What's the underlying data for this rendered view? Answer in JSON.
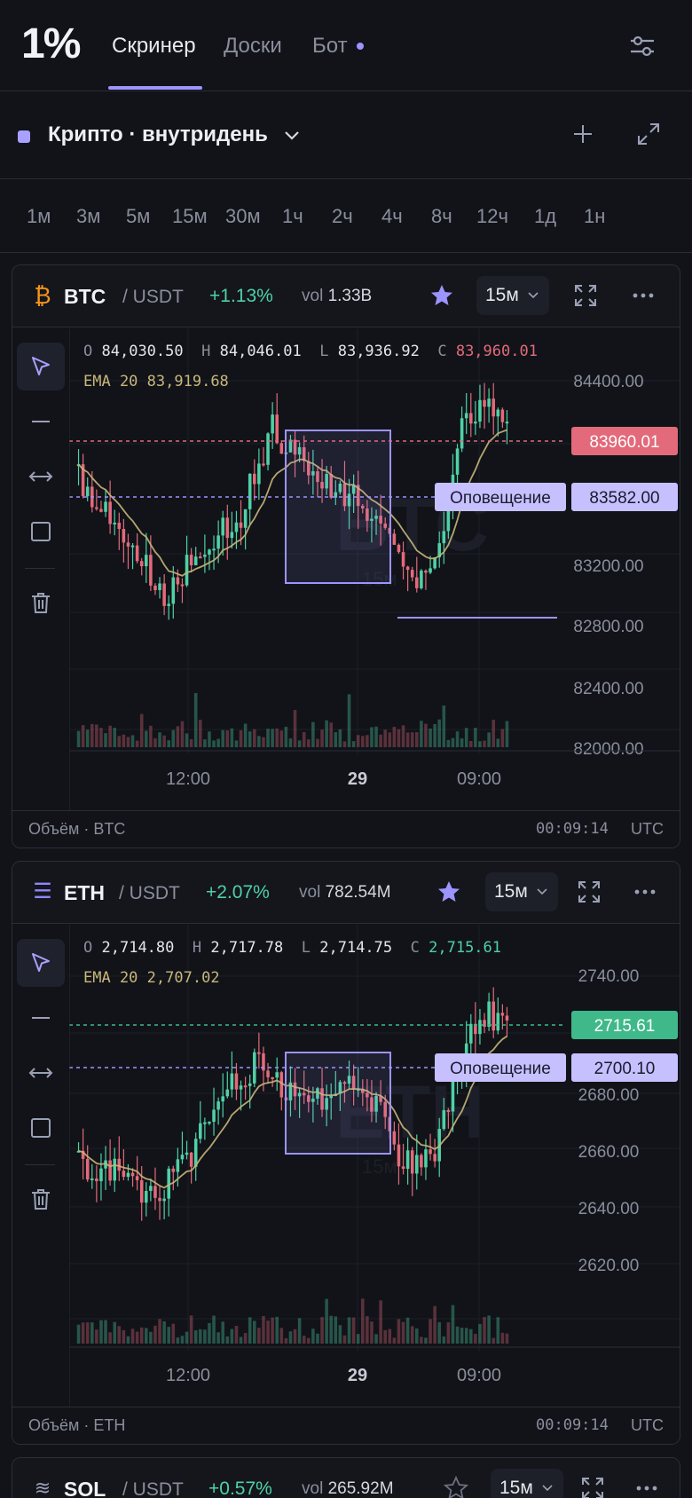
{
  "app": {
    "logo": "1%"
  },
  "nav": {
    "tabs": [
      {
        "label": "Скринер"
      },
      {
        "label": "Доски"
      },
      {
        "label": "Бот"
      }
    ]
  },
  "board": {
    "name": "Крипто · внутридень"
  },
  "intervals": [
    "1м",
    "3м",
    "5м",
    "15м",
    "30м",
    "1ч",
    "2ч",
    "4ч",
    "8ч",
    "12ч",
    "1д",
    "1н"
  ],
  "cards": [
    {
      "symbol": "BTC",
      "quote": "/ USDT",
      "change": "+1.13%",
      "vol_label": "vol",
      "vol_value": "1.33B",
      "timeframe": "15м",
      "icon": "bitcoin-icon",
      "icon_color": "#f7931a",
      "ohlc": {
        "o_label": "O",
        "o": "84,030.50",
        "h_label": "H",
        "h": "84,046.01",
        "l_label": "L",
        "l": "83,936.92",
        "c_label": "C",
        "c": "83,960.01",
        "c_dir": "down"
      },
      "ema": {
        "label": "EMA 20",
        "value": "83,919.68"
      },
      "watermark": "BTC",
      "watermark_tf": "15м",
      "price_axis": [
        "84400.00",
        "83200.00",
        "82800.00",
        "82400.00",
        "82000.00"
      ],
      "last_price": "83960.01",
      "last_price_color": "#e36a7a",
      "alert_label": "Оповещение",
      "alert_price": "83582.00",
      "time_axis": [
        "12:00",
        "29",
        "09:00"
      ],
      "footer": {
        "left": "Объём · BTC",
        "time": "00:09:14",
        "tz": "UTC"
      }
    },
    {
      "symbol": "ETH",
      "quote": "/ USDT",
      "change": "+2.07%",
      "vol_label": "vol",
      "vol_value": "782.54M",
      "timeframe": "15м",
      "icon": "ethereum-icon",
      "icon_color": "#8f87ff",
      "ohlc": {
        "o_label": "O",
        "o": "2,714.80",
        "h_label": "H",
        "h": "2,717.78",
        "l_label": "L",
        "l": "2,714.75",
        "c_label": "C",
        "c": "2,715.61",
        "c_dir": "up"
      },
      "ema": {
        "label": "EMA 20",
        "value": "2,707.02"
      },
      "watermark": "ETH",
      "watermark_tf": "15м",
      "price_axis": [
        "2740.00",
        "2680.00",
        "2660.00",
        "2640.00",
        "2620.00"
      ],
      "last_price": "2715.61",
      "last_price_color": "#3fb98a",
      "alert_label": "Оповещение",
      "alert_price": "2700.10",
      "time_axis": [
        "12:00",
        "29",
        "09:00"
      ],
      "footer": {
        "left": "Объём · ETH",
        "time": "00:09:14",
        "tz": "UTC"
      }
    },
    {
      "symbol": "SOL",
      "quote": "/ USDT",
      "change": "+0.57%",
      "vol_label": "vol",
      "vol_value": "265.92M",
      "timeframe": "15м",
      "icon": "solana-icon",
      "icon_color": "#9aa0b4"
    }
  ],
  "colors": {
    "accent": "#9d94ff",
    "up": "#4fd1a5",
    "down": "#e36a7a",
    "ema": "#c9b67a"
  }
}
